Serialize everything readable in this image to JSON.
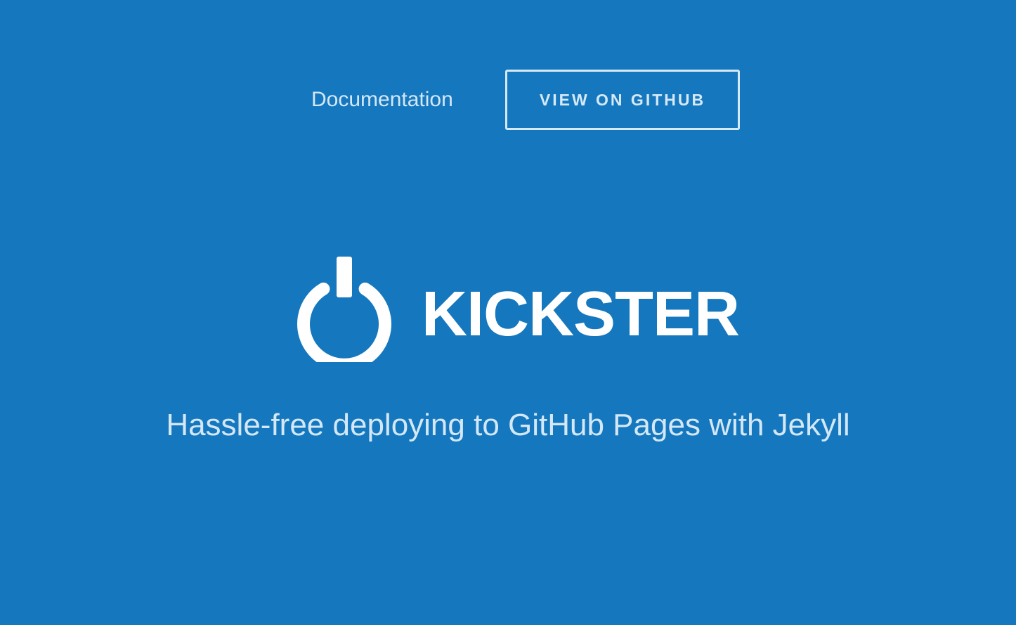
{
  "nav": {
    "documentation_label": "Documentation",
    "github_button_label": "VIEW ON GITHUB"
  },
  "hero": {
    "logo_icon": "power-icon",
    "brand_name": "KICKSTER",
    "tagline": "Hassle-free deploying to GitHub Pages with Jekyll"
  },
  "colors": {
    "background": "#1578be",
    "foreground": "#ffffff",
    "muted_text": "#d4e7f7"
  }
}
